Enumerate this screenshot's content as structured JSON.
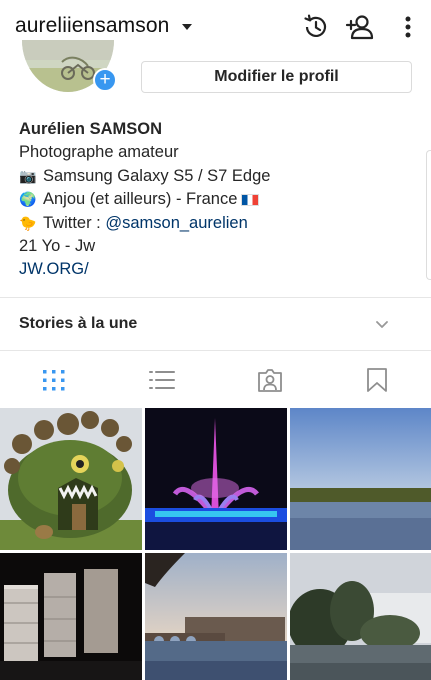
{
  "header": {
    "username": "aureliiensamson"
  },
  "profile": {
    "edit_button_label": "Modifier le profil",
    "add_story_badge": "+"
  },
  "bio": {
    "name": "Aurélien SAMSON",
    "line1": "Photographe amateur",
    "line2": "Samsung Galaxy S5 / S7 Edge",
    "line2_emoji": "📷",
    "line3": "Anjou (et ailleurs) - France",
    "line3_emoji": "🌍",
    "line4_prefix": "Twitter : ",
    "line4_emoji": "🐤",
    "twitter_handle": "@samson_aurelien",
    "line5": "21 Yo - Jw",
    "website": "JW.ORG/"
  },
  "stories": {
    "title": "Stories à la une"
  },
  "tabs": [
    {
      "name": "grid",
      "icon": "grid-icon",
      "active": true
    },
    {
      "name": "list",
      "icon": "list-icon",
      "active": false
    },
    {
      "name": "tagged",
      "icon": "tagged-user-icon",
      "active": false
    },
    {
      "name": "saved",
      "icon": "bookmark-icon",
      "active": false
    }
  ],
  "posts": [
    {
      "subject": "topiary-monster"
    },
    {
      "subject": "illuminated-fountain"
    },
    {
      "subject": "river-landscape"
    },
    {
      "subject": "castle-at-night"
    },
    {
      "subject": "bridge-at-dusk"
    },
    {
      "subject": "trees-by-river"
    }
  ],
  "colors": {
    "accent": "#3897f0",
    "link": "#003569",
    "text": "#262626",
    "active_tab": "#3897f0",
    "inactive_icon": "#8e8e8e"
  }
}
